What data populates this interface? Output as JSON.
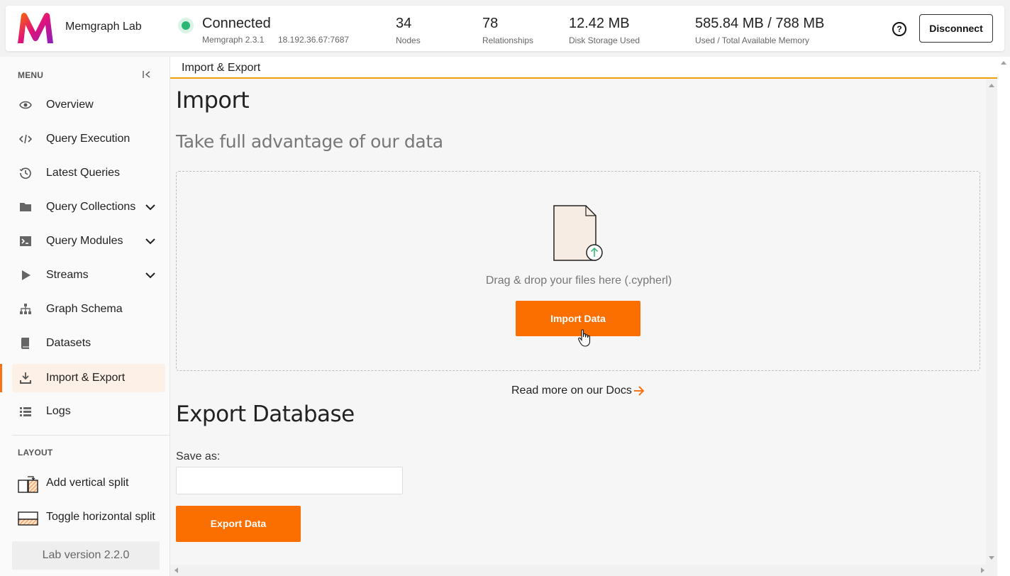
{
  "header": {
    "app_name": "Memgraph Lab",
    "brand_colors": [
      "#fb6e00",
      "#e0127a",
      "#8a1fbd"
    ],
    "connection": {
      "status": "Connected",
      "status_color": "#2bb673",
      "version": "Memgraph 2.3.1",
      "host": "18.192.36.67:7687"
    },
    "stats": [
      {
        "value": "34",
        "label": "Nodes"
      },
      {
        "value": "78",
        "label": "Relationships"
      },
      {
        "value": "12.42 MB",
        "label": "Disk Storage Used"
      },
      {
        "value": "585.84 MB / 788 MB",
        "label": "Used / Total Available Memory"
      }
    ],
    "help_label": "?",
    "disconnect_label": "Disconnect"
  },
  "sidebar": {
    "menu_title": "MENU",
    "items": [
      {
        "label": "Overview",
        "icon": "eye-icon"
      },
      {
        "label": "Query Execution",
        "icon": "code-icon"
      },
      {
        "label": "Latest Queries",
        "icon": "history-icon"
      },
      {
        "label": "Query Collections",
        "icon": "folder-icon",
        "expandable": true
      },
      {
        "label": "Query Modules",
        "icon": "terminal-icon",
        "expandable": true
      },
      {
        "label": "Streams",
        "icon": "play-icon",
        "expandable": true
      },
      {
        "label": "Graph Schema",
        "icon": "hierarchy-icon"
      },
      {
        "label": "Datasets",
        "icon": "book-icon"
      },
      {
        "label": "Import & Export",
        "icon": "download-icon",
        "active": true
      },
      {
        "label": "Logs",
        "icon": "list-icon"
      }
    ],
    "layout_title": "LAYOUT",
    "layout_items": [
      {
        "label": "Add vertical split",
        "icon": "vertical-split-icon"
      },
      {
        "label": "Toggle horizontal split",
        "icon": "horizontal-split-icon"
      }
    ],
    "lab_version": "Lab version 2.2.0",
    "accent_color": "#f97316"
  },
  "main": {
    "tab_label": "Import & Export",
    "import": {
      "title": "Import",
      "subtitle": "Take full advantage of our data",
      "drop_text": "Drag & drop your files here (.cypherl)",
      "button_label": "Import Data",
      "docs_link": "Read more on our Docs"
    },
    "export": {
      "title": "Export Database",
      "save_label": "Save as:",
      "save_value": "",
      "button_label": "Export Data"
    }
  }
}
